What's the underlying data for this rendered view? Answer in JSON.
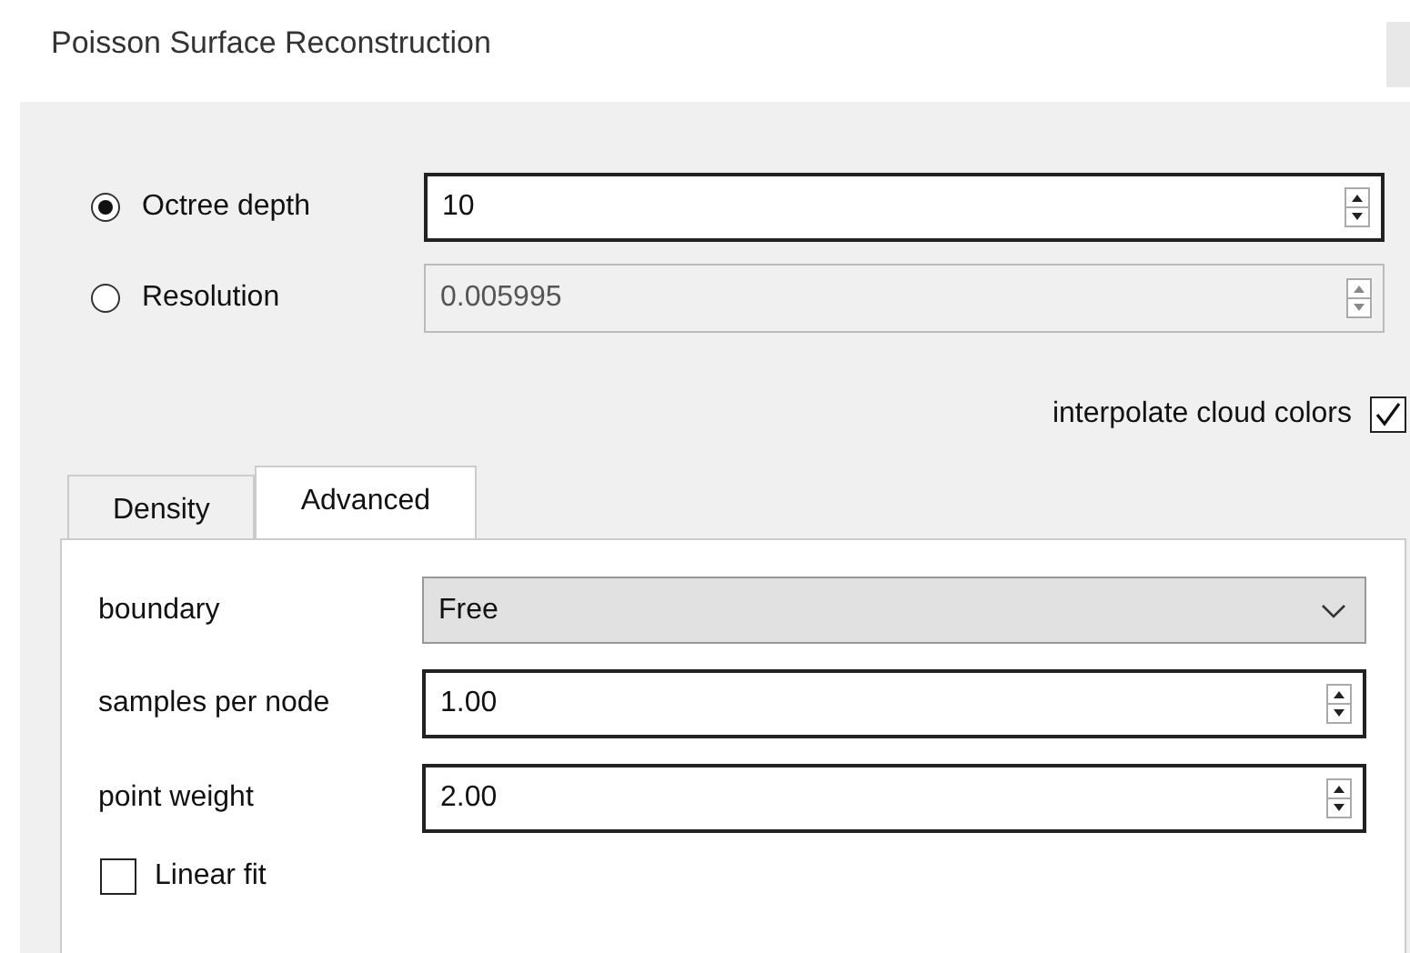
{
  "window": {
    "title": "Poisson Surface Reconstruction"
  },
  "modes": [
    {
      "label": "Octree depth",
      "selected": true,
      "value": "10",
      "disabled": false
    },
    {
      "label": "Resolution",
      "selected": false,
      "value": "0.005995",
      "disabled": true
    }
  ],
  "interpolate": {
    "label": "interpolate cloud colors",
    "checked": true
  },
  "tabs": [
    {
      "label": "Density",
      "selected": false
    },
    {
      "label": "Advanced",
      "selected": true
    }
  ],
  "fields": [
    {
      "kind": "combo",
      "label": "boundary",
      "value": "Free"
    },
    {
      "kind": "spin",
      "label": "samples per node",
      "value": "1.00"
    },
    {
      "kind": "spin",
      "label": "point weight",
      "value": "2.00"
    },
    {
      "kind": "checkbox",
      "label": "Linear fit",
      "checked": false
    }
  ]
}
